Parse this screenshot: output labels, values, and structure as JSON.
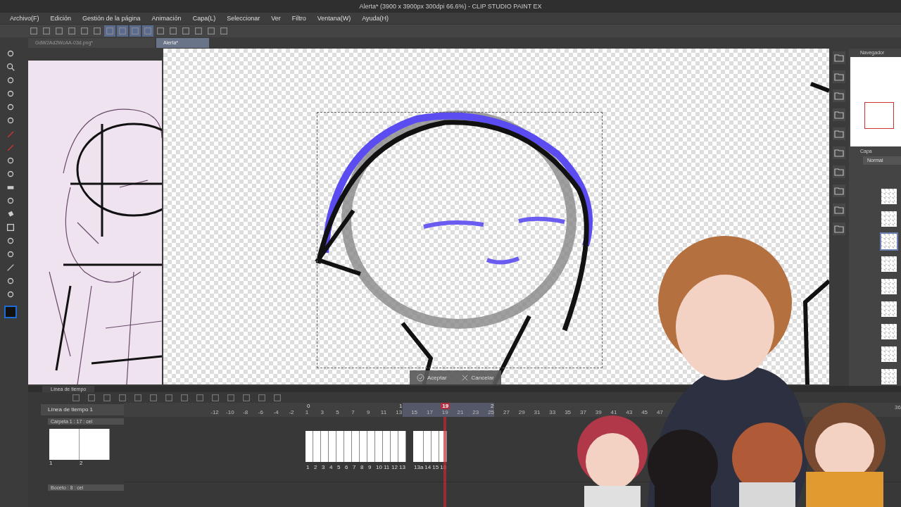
{
  "window": {
    "title": "Alerta* (3900 x 3900px 300dpi 66.6%) - CLIP STUDIO PAINT EX"
  },
  "menu": [
    "Archivo(F)",
    "Edición",
    "Gestión de la página",
    "Animación",
    "Capa(L)",
    "Seleccionar",
    "Ver",
    "Filtro",
    "Ventana(W)",
    "Ayuda(H)"
  ],
  "document_tabs": [
    {
      "label": "GdW2Ad2WcAA-03d.png*",
      "selected": false
    },
    {
      "label": "Alerta*",
      "selected": true
    }
  ],
  "transform_buttons": [
    {
      "label": "Aceptar",
      "kind": "accept"
    },
    {
      "label": "Cancelar",
      "kind": "cancel"
    }
  ],
  "navigator": {
    "title": "Navegador"
  },
  "layer_panel": {
    "title": "Capa",
    "blend_mode": "Normal",
    "layers": [
      {
        "selected": false
      },
      {
        "selected": false
      },
      {
        "selected": true
      },
      {
        "selected": false
      },
      {
        "selected": false
      },
      {
        "selected": false
      },
      {
        "selected": false
      },
      {
        "selected": false
      },
      {
        "selected": false
      }
    ]
  },
  "timeline": {
    "title": "Línea de tiempo",
    "timeline_name": "Línea de tiempo 1",
    "current_frame": "19",
    "section_labels": [
      "0",
      "1",
      "2"
    ],
    "ruler_before": [
      "-12",
      "-10",
      "-8",
      "-6",
      "-4",
      "-2"
    ],
    "ruler_after": [
      "1",
      "3",
      "5",
      "7",
      "9",
      "11",
      "13",
      "15",
      "17",
      "19",
      "21",
      "23",
      "25",
      "27",
      "29",
      "31",
      "33",
      "35",
      "37",
      "39",
      "41",
      "43",
      "45",
      "47"
    ],
    "end_label": "36",
    "tracks": [
      {
        "name": "Carpeta 1 : 17 : cel",
        "thumbnails": [
          "1",
          "2"
        ],
        "cel_groups": [
          [
            "1",
            "2",
            "3",
            "4",
            "5",
            "6",
            "7",
            "8",
            "9",
            "10",
            "11",
            "12",
            "13"
          ],
          [
            "13a",
            "14",
            "15",
            "16"
          ]
        ]
      },
      {
        "name": "Boceto : 8 : cel"
      }
    ]
  }
}
